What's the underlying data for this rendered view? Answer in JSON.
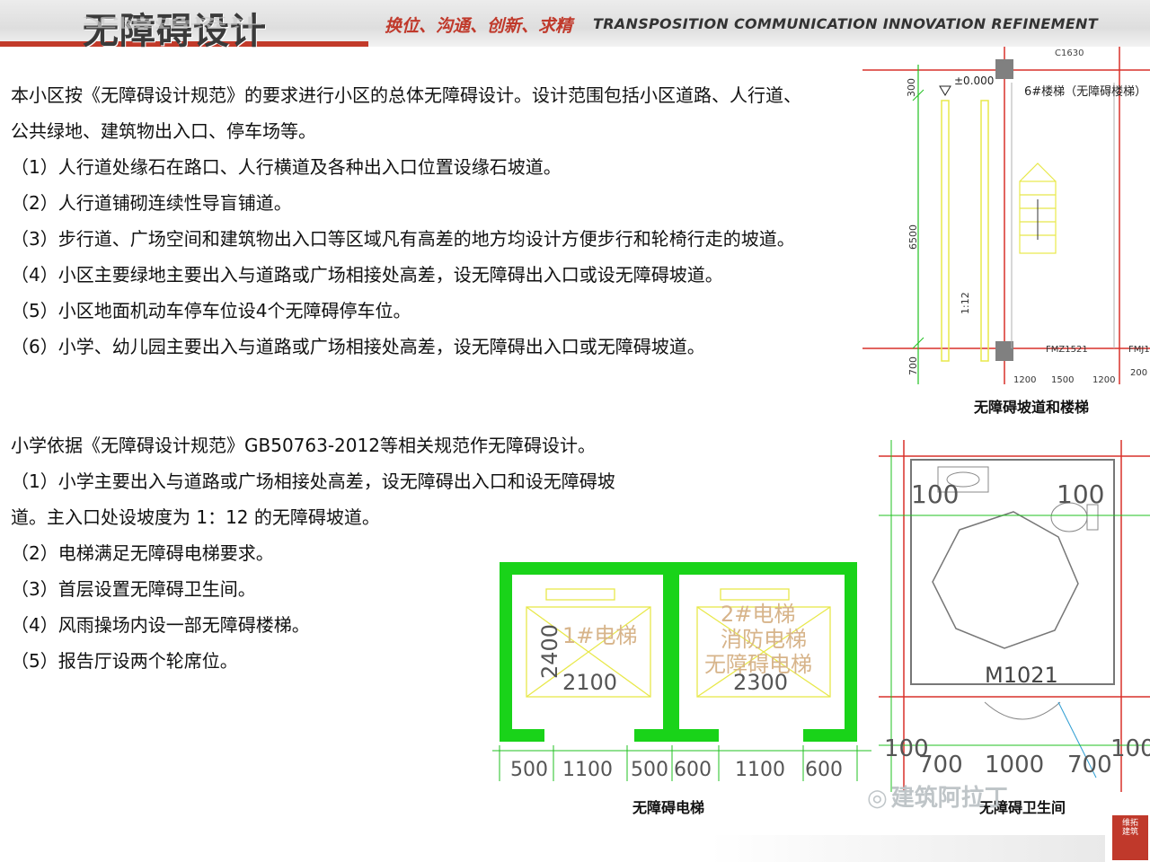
{
  "header": {
    "title": "无障碍设计",
    "slogan_cn": "换位、沟通、创新、求精",
    "slogan_en": "TRANSPOSITION COMMUNICATION INNOVATION REFINEMENT"
  },
  "section1": {
    "lines": [
      "本小区按《无障碍设计规范》的要求进行小区的总体无障碍设计。设计范围包括小区道路、人行道、",
      "公共绿地、建筑物出入口、停车场等。",
      "（1）人行道处缘石在路口、人行横道及各种出入口位置设缘石坡道。",
      "（2）人行道铺砌连续性导盲铺道。",
      "（3）步行道、广场空间和建筑物出入口等区域凡有高差的地方均设计方便步行和轮椅行走的坡道。",
      "（4）小区主要绿地主要出入与道路或广场相接处高差，设无障碍出入口或设无障碍坡道。",
      "（5）小区地面机动车停车位设4个无障碍停车位。",
      "（6）小学、幼儿园主要出入与道路或广场相接处高差，设无障碍出入口或无障碍坡道。"
    ]
  },
  "section2": {
    "lines": [
      "小学依据《无障碍设计规范》GB50763-2012等相关规范作无障碍设计。",
      "（1）小学主要出入与道路或广场相接处高差，设无障碍出入口和设无障碍坡",
      "道。主入口处设坡度为 1：12 的无障碍坡道。",
      "（2）电梯满足无障碍电梯要求。",
      "（3）首层设置无障碍卫生间。",
      "（4）风雨操场内设一部无障碍楼梯。",
      "（5）报告厅设两个轮席位。"
    ]
  },
  "drawing_ramp": {
    "caption": "无障碍坡道和楼梯",
    "elev": "±0.000",
    "stair_label": "6#楼梯（无障碍楼梯）",
    "dims_vertical": [
      "300",
      "6500",
      "700"
    ],
    "slope": "1:12",
    "door": "FMZ1521",
    "door2": "FMJ1",
    "dims_bottom": [
      "1200",
      "1500",
      "1200",
      "200"
    ],
    "top_label": "C1630"
  },
  "drawing_elevator": {
    "caption": "无障碍电梯",
    "car1_label": "1#电梯",
    "car1_w": "2100",
    "car1_h": "2400",
    "car2_line1": "2#电梯",
    "car2_line2": "消防电梯",
    "car2_line3": "无障碍电梯",
    "car2_w": "2300",
    "dims_bottom": [
      "500",
      "1100",
      "500",
      "600",
      "1100",
      "600"
    ]
  },
  "drawing_toilet": {
    "caption": "无障碍卫生间",
    "dim_left": "100",
    "dim_right": "100",
    "door": "M1021",
    "dims_bottom": [
      "100",
      "700",
      "1000",
      "700",
      "100"
    ]
  },
  "watermark": "建筑阿拉丁",
  "stamp": "维拓建筑",
  "colors": {
    "accent_red": "#c0392b",
    "green_wall": "#19d319",
    "cad_yellow": "#e8e84a",
    "cad_red": "#d9302a"
  }
}
